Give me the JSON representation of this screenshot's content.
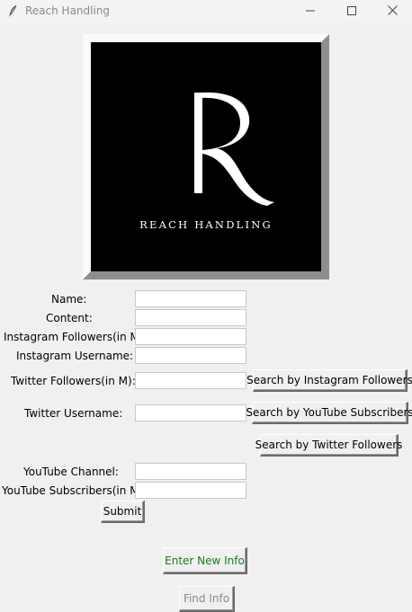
{
  "window": {
    "title": "Reach Handling",
    "app_icon": "feather-icon",
    "controls": [
      "minimize-icon",
      "maximize-icon",
      "close-icon"
    ]
  },
  "logo": {
    "letter": "R",
    "wordmark": "REACH HANDLING"
  },
  "form": {
    "name_label": "Name:",
    "content_label": "Content:",
    "instagram_followers_label": "Instagram Followers(in M):",
    "instagram_username_label": "Instagram Username:",
    "twitter_followers_label": "Twitter Followers(in M):",
    "twitter_username_label": "Twitter Username:",
    "youtube_channel_label": "YouTube Channel:",
    "youtube_subscribers_label": "YouTube Subscribers(in M):",
    "name_value": "",
    "content_value": "",
    "instagram_followers_value": "",
    "instagram_username_value": "",
    "twitter_followers_value": "",
    "twitter_username_value": "",
    "youtube_channel_value": "",
    "youtube_subscribers_value": "",
    "submit_label": "Submit"
  },
  "search": {
    "instagram_label": "Search by Instagram Followers",
    "youtube_label": "Search by YouTube Subscribers",
    "twitter_label": "Search by Twitter Followers"
  },
  "actions": {
    "enter_new_info_label": "Enter New Info",
    "enter_new_info_color": "#1a7a1a",
    "find_info_label": "Find Info",
    "find_info_state": "disabled"
  }
}
